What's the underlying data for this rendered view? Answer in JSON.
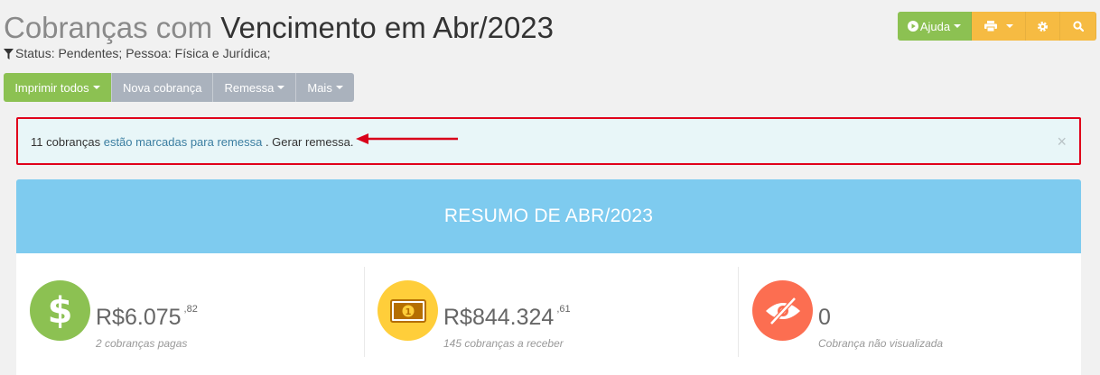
{
  "header": {
    "title_light": "Cobranças com",
    "title_dark": "Vencimento em Abr/2023",
    "filter_text": "Status: Pendentes; Pessoa: Física e Jurídica;"
  },
  "toolbar_right": {
    "help_label": "Ajuda",
    "icons": [
      "play-circle-icon",
      "printer-icon",
      "gear-icon",
      "search-icon"
    ]
  },
  "actions": {
    "print_all": "Imprimir todos",
    "new_charge": "Nova cobrança",
    "remittance": "Remessa",
    "more": "Mais"
  },
  "alert": {
    "count_text": "11 cobranças",
    "link_text": "estão marcadas para remessa",
    "action_text": ". Gerar remessa.",
    "close_symbol": "×"
  },
  "summary": {
    "title": "RESUMO DE ABR/2023",
    "stats": [
      {
        "currency": "R$",
        "value": "6.075",
        "cents": ",82",
        "desc": "2 cobranças pagas",
        "color": "#8cc152",
        "icon": "dollar-icon"
      },
      {
        "currency": "R$",
        "value": "844.324",
        "cents": ",61",
        "desc": "145 cobranças a receber",
        "color": "#ffce3a",
        "icon": "banknote-icon"
      },
      {
        "currency": "",
        "value": "0",
        "cents": "",
        "desc": "Cobrança não visualizada",
        "color": "#fc6e51",
        "icon": "eye-slash-icon"
      }
    ]
  },
  "colors": {
    "green": "#8cc152",
    "yellow": "#f6bb42",
    "gray_button": "#aab2bd",
    "blue_header": "#7ecbef",
    "alert_border": "#e0001a"
  }
}
